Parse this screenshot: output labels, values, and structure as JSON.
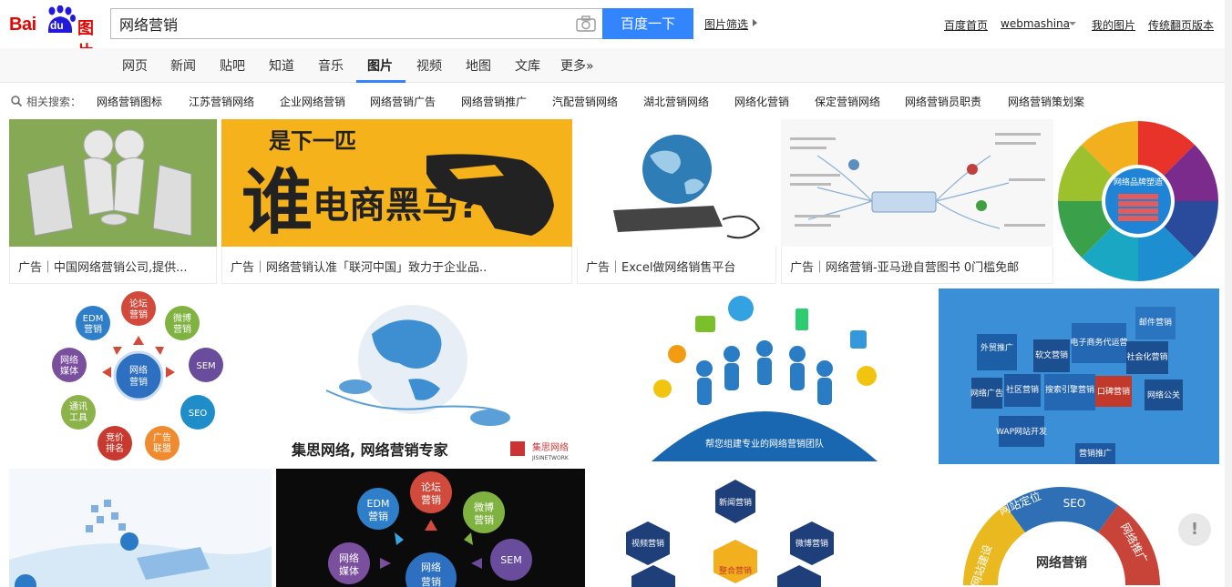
{
  "header": {
    "logo_text": "Bai",
    "logo_du": "du",
    "logo_suffix": "图片",
    "search_value": "网络营销",
    "search_button": "百度一下",
    "filter_label": "图片筛选",
    "links": {
      "home": "百度首页",
      "user": "webmashina",
      "my_images": "我的图片",
      "classic": "传统翻页版本"
    }
  },
  "nav": {
    "tabs": [
      "网页",
      "新闻",
      "贴吧",
      "知道",
      "音乐",
      "图片",
      "视频",
      "地图",
      "文库",
      "更多»"
    ],
    "active": "图片"
  },
  "related": {
    "label": "相关搜索：",
    "items": [
      "网络营销图标",
      "江苏营销网络",
      "企业网络营销",
      "网络营销广告",
      "网络营销推广",
      "汽配营销网络",
      "湖北营销网络",
      "网络化营销",
      "保定营销网络",
      "网络营销员职责",
      "网络营销策划案"
    ]
  },
  "results": {
    "ads": [
      "广告｜中国网络营销公司,提供...",
      "广告｜网络营销认准「联河中国」致力于企业品..",
      "广告｜Excel做网络销售平台",
      "广告｜网络营销-亚马逊自营图书 0门槛免邮"
    ],
    "ad_image_text": "谁是下一匹电商黑马?",
    "ad_image_text_top": "是下一匹",
    "ad_image_text_big": "谁",
    "ad_image_text_bottom": "电商黑马?",
    "wheel_center": "网络品牌塑造",
    "network_graphic": {
      "center": [
        "网络",
        "营销"
      ],
      "nodes": [
        [
          "论坛",
          "营销"
        ],
        [
          "微博",
          "营销"
        ],
        [
          "SEM"
        ],
        [
          "SEO"
        ],
        [
          "广告",
          "联盟"
        ],
        [
          "竞价",
          "排名"
        ],
        [
          "通讯",
          "工具"
        ],
        [
          "网络",
          "媒体"
        ],
        [
          "EDM",
          "营销"
        ]
      ]
    },
    "globe_caption": "集思网络, 网络营销专家",
    "globe_logo": [
      "集思网络",
      "JISINETWORK"
    ],
    "team_caption": "帮您组建专业的网络营销团队",
    "cube_labels": [
      "外贸推广",
      "软文营销",
      "电子商务代运营",
      "社会化营销",
      "邮件营销",
      "社区营销",
      "搜索引擎营销",
      "口碑营销",
      "网络公关",
      "网络广告",
      "WAP网站开发",
      "营销推广"
    ],
    "black_graphic_nodes": [
      [
        "论坛",
        "营销"
      ],
      [
        "EDM",
        "营销"
      ],
      [
        "微博",
        "营销"
      ],
      [
        "网络",
        "媒体"
      ],
      [
        "SEM"
      ],
      [
        "网络",
        "营销"
      ]
    ],
    "hex_labels": [
      "新闻营销",
      "视频营销",
      "微博营销",
      "整合营销"
    ],
    "ring_labels": [
      "网站定位",
      "SEO",
      "网络推广",
      "网站建设"
    ],
    "ring_center": "网络营销"
  },
  "feedback_icon": "!"
}
